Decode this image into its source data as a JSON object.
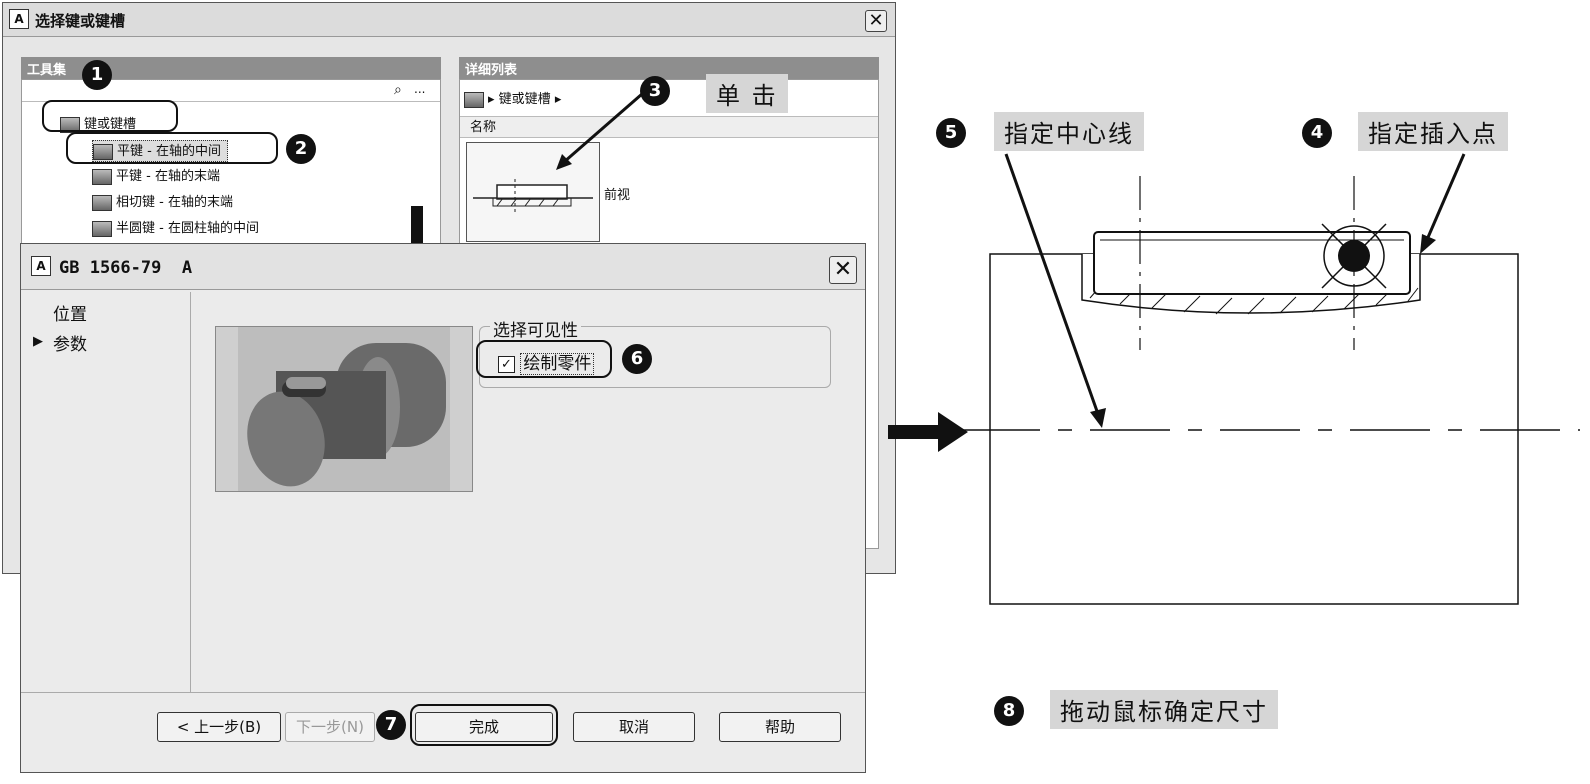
{
  "back_window": {
    "title": "选择键或键槽",
    "close": "✕",
    "toolset_header": "工具集",
    "search_dots": "...",
    "tree": [
      {
        "label": "键或键槽"
      },
      {
        "label": "平键 - 在轴的中间"
      },
      {
        "label": "平键 - 在轴的末端"
      },
      {
        "label": "相切键 - 在轴的末端"
      },
      {
        "label": "半圆键 - 在圆柱轴的中间"
      }
    ],
    "detail_header": "详细列表",
    "breadcrumb": "键或键槽",
    "col_name": "名称",
    "thumb_label": "前视"
  },
  "front_window": {
    "title": "GB 1566-79  A",
    "close": "✕",
    "nav": [
      "位置",
      "参数"
    ],
    "nav_selected_marker": "▶",
    "group_title": "选择可见性",
    "checkbox_label": "绘制零件",
    "checkbox_checked": true,
    "buttons": {
      "back": "< 上一步(B)",
      "next": "下一步(N)",
      "finish": "完成",
      "cancel": "取消",
      "help": "帮助"
    }
  },
  "callouts": {
    "c1": "1",
    "c2": "2",
    "c3": "3",
    "c3_text": "单 击",
    "c4": "4",
    "c4_text": "指定插入点",
    "c5": "5",
    "c5_text": "指定中心线",
    "c6": "6",
    "c7": "7",
    "c8": "8",
    "c8_text": "拖动鼠标确定尺寸"
  }
}
